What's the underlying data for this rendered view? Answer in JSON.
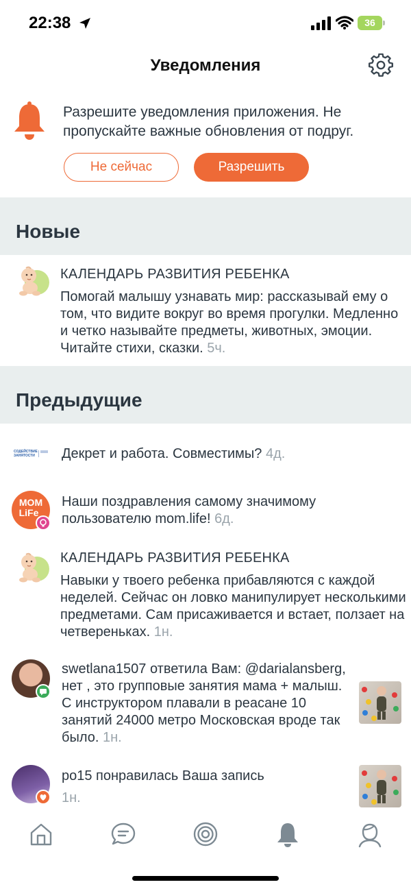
{
  "status_bar": {
    "time": "22:38",
    "battery": "36",
    "icons": [
      "location-arrow-icon",
      "cellular-signal-icon",
      "wifi-icon",
      "battery-icon"
    ]
  },
  "header": {
    "title": "Уведомления",
    "settings_icon": "gear-icon"
  },
  "permission_banner": {
    "icon": "bell-icon",
    "text": "Разрешите уведомления приложения. Не пропускайте важные обновления от подруг.",
    "not_now_label": "Не сейчас",
    "allow_label": "Разрешить",
    "accent_color": "#ee6a37"
  },
  "sections": {
    "new_title": "Новые",
    "previous_title": "Предыдущие"
  },
  "new_items": [
    {
      "title": "КАЛЕНДАРЬ РАЗВИТИЯ РЕБЕНКА",
      "body": "Помогай малышу узнавать мир: рассказывай ему о том, что видите вокруг во время прогулки. Медленно и четко называйте предметы, животных, эмоции. Читайте стихи, сказки.",
      "time": "5ч."
    }
  ],
  "previous_items": [
    {
      "body": "Декрет и работа. Совместимы?",
      "time": "4д.",
      "logo_text": "СОДЕЙСТВИЕ ЗАНЯТОСТИ"
    },
    {
      "body": "Наши поздравления самому значимому пользователю mom.life!",
      "time": "6д.",
      "logo_text_1": "MOM",
      "logo_text_2": "LiFe"
    },
    {
      "title": "КАЛЕНДАРЬ РАЗВИТИЯ РЕБЕНКА",
      "body": "Навыки у твоего ребенка прибавляются с каждой неделей. Сейчас он ловко манипулирует несколькими предметами. Сам присаживается и встает, ползает на четвереньках.",
      "time": "1н."
    },
    {
      "user": "swetlana1507",
      "action": " ответила Вам:",
      "body": "@darialansberg, нет , это групповые занятия мама + малыш. С инструктором плавали в реасане 10 занятий 24000 метро Московская вроде так было.",
      "time": "1н."
    },
    {
      "user": "po15",
      "action": " понравилась Ваша запись",
      "time": "1н."
    }
  ],
  "tabbar": {
    "icons": [
      "home-icon",
      "chat-icon",
      "target-icon",
      "bell-tab-icon",
      "profile-icon"
    ]
  }
}
